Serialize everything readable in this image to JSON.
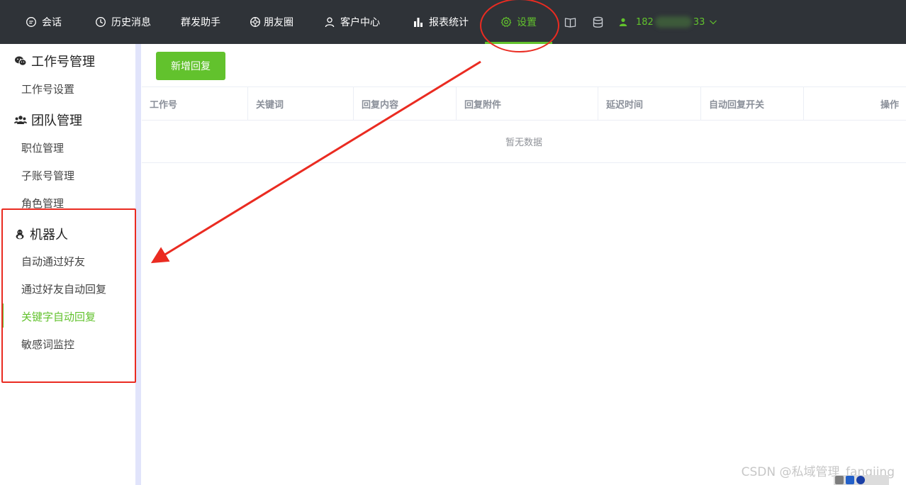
{
  "nav": {
    "items": [
      {
        "label": "会话",
        "icon": "chat-bubble-icon"
      },
      {
        "label": "历史消息",
        "icon": "clock-icon"
      },
      {
        "label": "群发助手",
        "icon": ""
      },
      {
        "label": "朋友圈",
        "icon": "aperture-icon"
      },
      {
        "label": "客户中心",
        "icon": "person-outline-icon"
      },
      {
        "label": "报表统计",
        "icon": "bar-chart-icon"
      },
      {
        "label": "设置",
        "icon": "gear-icon",
        "active": true
      }
    ],
    "extra_icons": [
      "book-icon",
      "database-icon"
    ],
    "user": {
      "prefix": "182",
      "suffix": "33",
      "icon": "user-icon",
      "dropdown_icon": "chevron-down-icon"
    }
  },
  "sidebar": {
    "groups": [
      {
        "title": "工作号管理",
        "icon": "wechat-icon",
        "items": [
          "工作号设置"
        ]
      },
      {
        "title": "团队管理",
        "icon": "team-icon",
        "items": [
          "职位管理",
          "子账号管理",
          "角色管理"
        ]
      },
      {
        "title": "机器人",
        "icon": "robot-icon",
        "items": [
          "自动通过好友",
          "通过好友自动回复",
          "关键字自动回复",
          "敏感词监控"
        ]
      }
    ],
    "active_item": "关键字自动回复"
  },
  "main": {
    "add_button": "新增回复",
    "table": {
      "columns": [
        "工作号",
        "关键词",
        "回复内容",
        "回复附件",
        "延迟时间",
        "自动回复开关",
        "操作"
      ],
      "rows": [],
      "empty_text": "暂无数据"
    }
  },
  "watermark": "CSDN @私域管理_fangjing",
  "colors": {
    "accent": "#62c22d",
    "topbar": "#2f3338",
    "annotation": "#ea2b21"
  }
}
